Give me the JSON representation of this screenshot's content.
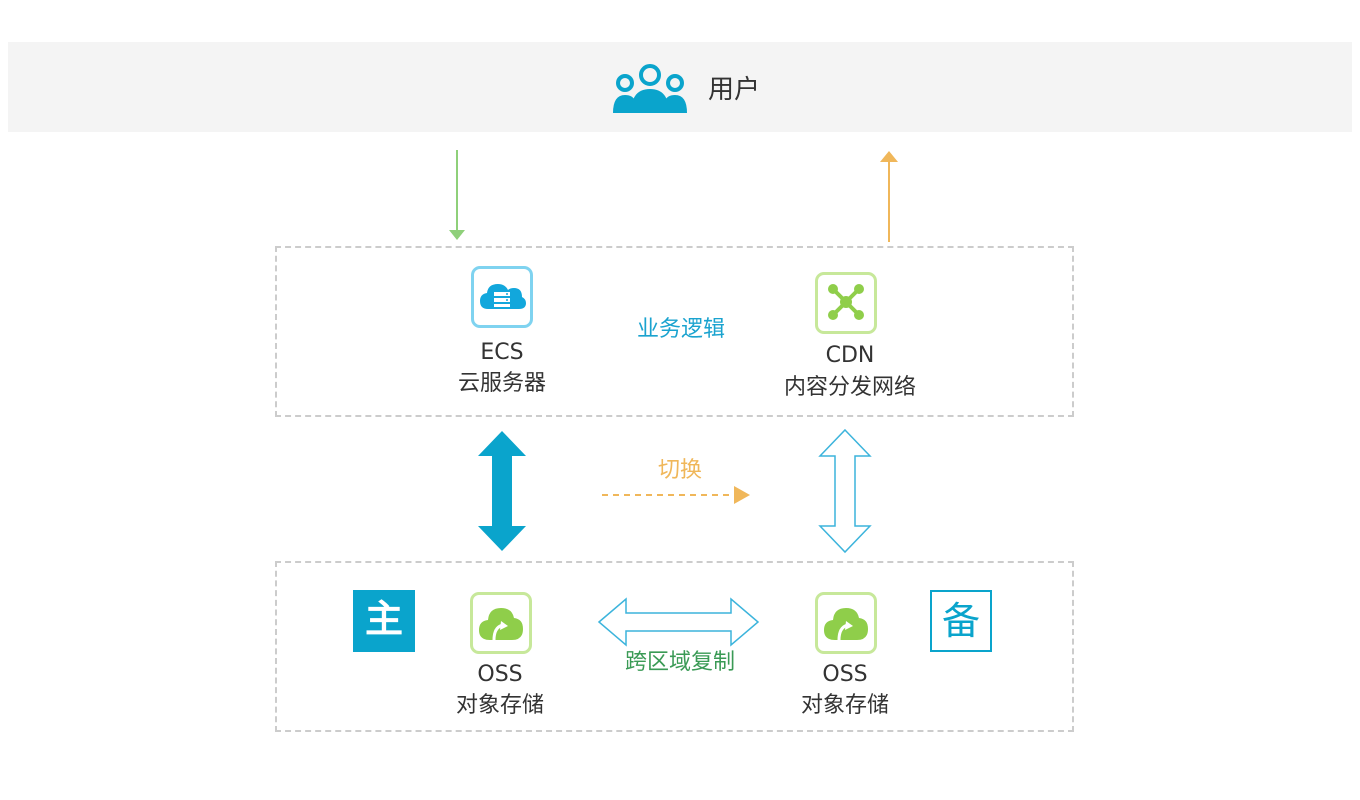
{
  "user": {
    "label": "用户",
    "icon": "users-icon",
    "icon_color": "#0aa4cc"
  },
  "logic_box": {
    "label": "业务逻辑",
    "label_color": "#1aa3cf",
    "ecs": {
      "name": "ECS",
      "desc": "云服务器",
      "icon": "cloud-server-icon"
    },
    "cdn": {
      "name": "CDN",
      "desc": "内容分发网络",
      "icon": "network-nodes-icon"
    }
  },
  "switch": {
    "label": "切换",
    "color": "#f0b75a"
  },
  "storage_box": {
    "label": "跨区域复制",
    "label_color": "#3a9a55",
    "primary": {
      "badge": "主",
      "name": "OSS",
      "desc": "对象存储",
      "icon": "oss-storage-icon"
    },
    "backup": {
      "badge": "备",
      "name": "OSS",
      "desc": "对象存储",
      "icon": "oss-storage-icon"
    }
  },
  "colors": {
    "accent_blue": "#0aa4cc",
    "down_arrow_green": "#8fd07a",
    "up_arrow_orange": "#f0b75a",
    "icon_green": "#a8dc6a",
    "hollow_arrow_blue": "#3cb4dc"
  }
}
